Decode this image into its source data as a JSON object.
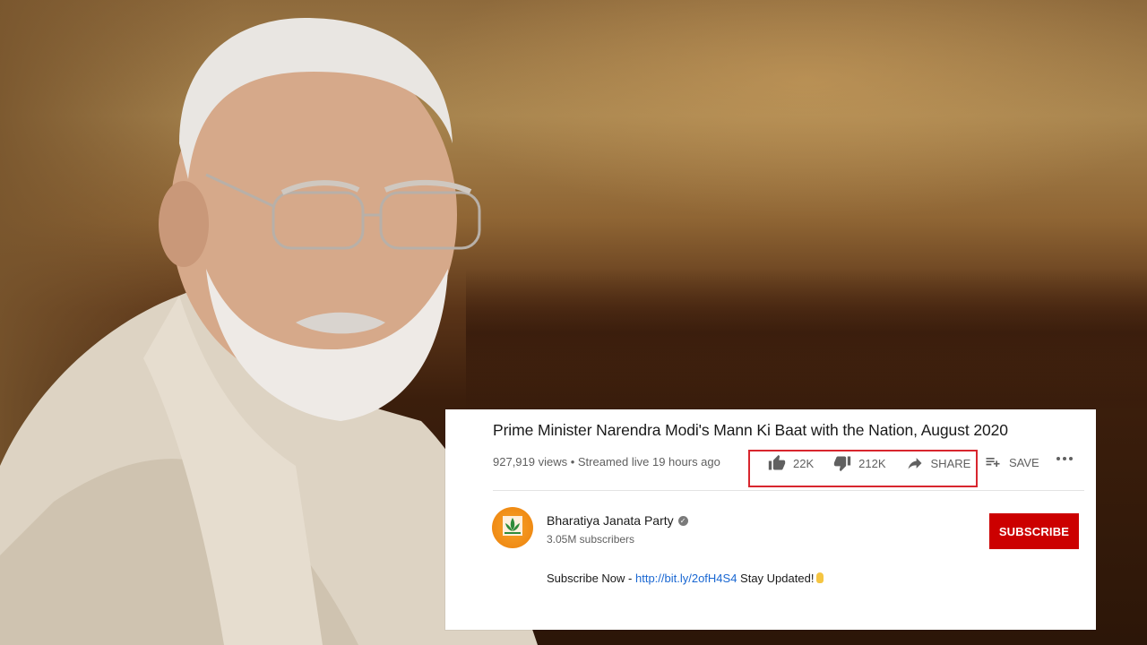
{
  "video": {
    "title": "Prime Minister Narendra Modi's Mann Ki Baat with the Nation, August 2020",
    "meta": "927,919 views • Streamed live 19 hours ago"
  },
  "actions": {
    "like_count": "22K",
    "dislike_count": "212K",
    "share_label": "SHARE",
    "save_label": "SAVE"
  },
  "channel": {
    "name": "Bharatiya Janata Party",
    "subscribers": "3.05M subscribers",
    "subscribe_label": "SUBSCRIBE"
  },
  "description": {
    "prefix": "Subscribe Now - ",
    "link": "http://bit.ly/2ofH4S4",
    "suffix": " Stay Updated!"
  },
  "colors": {
    "subscribe": "#cc0000",
    "highlight_box": "#d8262e",
    "link": "#1967d2"
  },
  "icons": [
    "like-icon",
    "dislike-icon",
    "share-icon",
    "save-to-playlist-icon",
    "more-icon",
    "verified-icon",
    "hand-icon",
    "bjp-lotus-logo"
  ]
}
